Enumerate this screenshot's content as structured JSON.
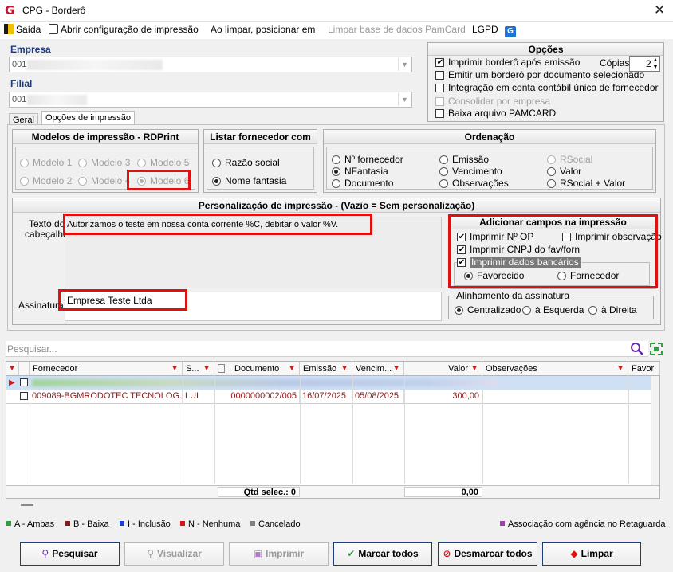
{
  "window": {
    "title": "CPG - Borderô",
    "close_glyph": "✕",
    "app_glyph": "G"
  },
  "menu": {
    "saida": "Saída",
    "abrir_config": "Abrir configuração de impressão",
    "ao_limpar": "Ao limpar, posicionar em",
    "limpar_base": "Limpar base de dados PamCard",
    "lgpd": "LGPD",
    "lgpd_badge": "G"
  },
  "empresa": {
    "label": "Empresa",
    "value": "001"
  },
  "filial": {
    "label": "Filial",
    "value": "001"
  },
  "tabs": [
    "Geral",
    "Opções de impressão"
  ],
  "opcoes": {
    "title": "Opções",
    "items": [
      {
        "label": "Imprimir borderô após emissão",
        "checked": true,
        "disabled": false
      },
      {
        "label": "Emitir um borderô por documento selecionado",
        "checked": false,
        "disabled": false
      },
      {
        "label": "Integração em conta contábil única de fornecedor",
        "checked": false,
        "disabled": false
      },
      {
        "label": "Consolidar por empresa",
        "checked": false,
        "disabled": true
      },
      {
        "label": "Baixa arquivo PAMCARD",
        "checked": false,
        "disabled": false
      }
    ],
    "copias_label": "Cópias",
    "copias_value": "2"
  },
  "modelos": {
    "title": "Modelos de impressão - RDPrint",
    "items": [
      "Modelo 1",
      "Modelo 3",
      "Modelo 5",
      "Modelo 2",
      "Modelo 4",
      "Modelo 6"
    ],
    "selected": "Modelo 6"
  },
  "listar": {
    "title": "Listar fornecedor com",
    "items": [
      "Razão social",
      "Nome fantasia"
    ],
    "selected": "Nome fantasia"
  },
  "ordenacao": {
    "title": "Ordenação",
    "items": [
      "Nº fornecedor",
      "NFantasia",
      "Documento",
      "Emissão",
      "Vencimento",
      "Observações",
      "RSocial",
      "Valor",
      "RSocial + Valor"
    ],
    "selected": "NFantasia",
    "disabled": [
      "RSocial"
    ]
  },
  "personalizacao": {
    "title": "Personalização de impressão - (Vazio = Sem personalização)",
    "texto_label_1": "Texto do",
    "texto_label_2": "cabeçalho:",
    "texto_value": "Autorizamos o teste em nossa conta corrente %C, debitar o valor %V.",
    "assinatura_label": "Assinatura",
    "assinatura_value": "Empresa Teste Ltda"
  },
  "adicionar": {
    "title": "Adicionar campos na impressão",
    "imprimir_op": "Imprimir Nº OP",
    "imprimir_obs": "Imprimir observação",
    "imprimir_cnpj": "Imprimir CNPJ do fav/forn",
    "imprimir_dados": "Imprimir dados bancários",
    "favorecido": "Favorecido",
    "fornecedor": "Fornecedor",
    "selected": "Favorecido"
  },
  "alinhamento": {
    "title": "Alinhamento da assinatura",
    "items": [
      "Centralizado",
      "à Esquerda",
      "à Direita"
    ],
    "selected": "Centralizado"
  },
  "search": {
    "placeholder": "Pesquisar..."
  },
  "grid": {
    "columns": [
      "Fornecedor",
      "S...",
      "Documento",
      "Emissão",
      "Vencim...",
      "Valor",
      "Observações",
      "Favor"
    ],
    "rows": [
      {
        "fornecedor": "009089-BGMRODOTEC TECNOLOG...",
        "s": "LUI",
        "documento": "0000000002/005",
        "emissao": "16/07/2025",
        "vencimento": "05/08/2025",
        "valor": "300,00",
        "obs": ""
      }
    ],
    "footer_qtd": "Qtd selec.: 0",
    "footer_total": "0,00"
  },
  "legend": {
    "items": [
      {
        "label": "A - Ambas",
        "color": "#2e9e3e"
      },
      {
        "label": "B - Baixa",
        "color": "#8b1a1a"
      },
      {
        "label": "I - Inclusão",
        "color": "#1a3fd6"
      },
      {
        "label": "N - Nenhuma",
        "color": "#e01010"
      },
      {
        "label": "Cancelado",
        "color": "#808080"
      }
    ],
    "right": {
      "label": "Associação com agência no Retaguarda",
      "color": "#a040b0"
    }
  },
  "buttons": {
    "pesquisar": "Pesquisar",
    "visualizar": "Visualizar",
    "imprimir": "Imprimir",
    "marcar": "Marcar todos",
    "desmarcar": "Desmarcar todos",
    "limpar": "Limpar"
  }
}
